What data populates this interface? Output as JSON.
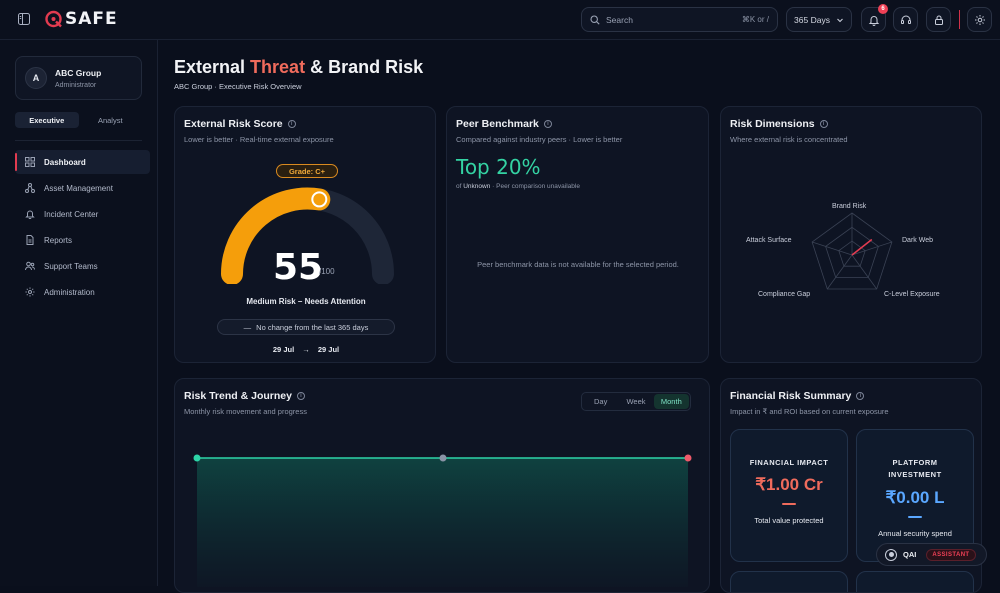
{
  "topbar": {
    "logo_text": "SAFE",
    "search_placeholder": "Search",
    "search_shortcut": "⌘K or /",
    "period": "365 Days",
    "notifications_count": "6",
    "accent": "#e23b50"
  },
  "sidebar": {
    "org_initial": "A",
    "org_name": "ABC Group",
    "org_role": "Administrator",
    "modes": [
      "Executive",
      "Analyst"
    ],
    "active_mode": "Executive",
    "items": [
      {
        "label": "Dashboard",
        "icon": "dashboard-icon",
        "active": true
      },
      {
        "label": "Asset Management",
        "icon": "network-icon",
        "active": false
      },
      {
        "label": "Incident Center",
        "icon": "bell-icon",
        "active": false
      },
      {
        "label": "Reports",
        "icon": "document-icon",
        "active": false
      },
      {
        "label": "Support Teams",
        "icon": "users-icon",
        "active": false
      },
      {
        "label": "Administration",
        "icon": "gear-icon",
        "active": false
      }
    ]
  },
  "page": {
    "title_part1": "External ",
    "title_highlight": "Threat",
    "title_part2": " & Brand Risk",
    "subtitle": "ABC Group · Executive Risk Overview"
  },
  "risk_score": {
    "title": "External Risk Score",
    "subtitle": "Lower is better · Real-time external exposure",
    "grade": "Grade: C+",
    "score": "55",
    "max": "/100",
    "score_fraction": 0.55,
    "label": "Medium Risk – Needs Attention",
    "change": "No change from the last 365 days",
    "date_from": "29 Jul",
    "date_to": "29 Jul",
    "gauge_color": "#f59e0b"
  },
  "peer": {
    "title": "Peer Benchmark",
    "subtitle": "Compared against industry peers · Lower is better",
    "value": "Top 20%",
    "note_prefix": "of ",
    "note_strong": "Unknown",
    "note_suffix": " · Peer comparison unavailable",
    "empty": "Peer benchmark data is not available for the selected period."
  },
  "dimensions": {
    "title": "Risk Dimensions",
    "subtitle": "Where external risk is concentrated",
    "axes": [
      "Brand Risk",
      "Dark Web",
      "C-Level Exposure",
      "Compliance Gap",
      "Attack Surface"
    ],
    "values": [
      0,
      0.6,
      0,
      0,
      0
    ],
    "accent": "#e23b50"
  },
  "trend": {
    "title": "Risk Trend & Journey",
    "subtitle": "Monthly risk movement and progress",
    "granularity": [
      "Day",
      "Week",
      "Month"
    ],
    "active": "Month",
    "points": [
      {
        "color": "#2dd4a7"
      },
      {
        "color": "#8a93a6"
      },
      {
        "color": "#ef5a6a"
      }
    ]
  },
  "financial": {
    "title": "Financial Risk Summary",
    "subtitle": "Impact in ₹ and ROI based on current exposure",
    "impact_label": "FINANCIAL IMPACT",
    "impact_value": "₹1.00 Cr",
    "impact_desc": "Total value protected",
    "invest_label1": "PLATFORM",
    "invest_label2": "INVESTMENT",
    "invest_value": "₹0.00 L",
    "invest_desc": "Annual security spend"
  },
  "assistant": {
    "name": "QAI",
    "tag": "ASSISTANT"
  }
}
